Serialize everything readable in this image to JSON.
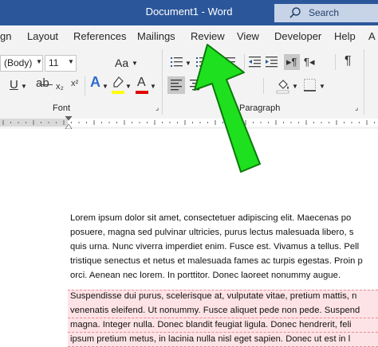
{
  "title_bar": {
    "title": "Document1  -  Word",
    "search_label": "Search",
    "colors": {
      "bar": "#2b579a",
      "search_bg": "#c7d3e6"
    }
  },
  "tabs": [
    "gn",
    "Layout",
    "References",
    "Mailings",
    "Review",
    "View",
    "Developer",
    "Help",
    "A"
  ],
  "ribbon": {
    "font_name": "(Body)",
    "font_size": "11",
    "grow_shrink": "Aa",
    "font_group_label": "Font",
    "paragraph_group_label": "Paragraph",
    "font_color_letter": "A",
    "highlight_color": "#ffff00",
    "font_color": "#e00000",
    "pilcrow": "¶"
  },
  "document": {
    "paragraph1": [
      "Lorem ipsum dolor sit amet, consectetuer adipiscing elit. Maecenas po",
      "posuere, magna sed pulvinar ultricies, purus lectus malesuada libero, s",
      "quis urna. Nunc viverra imperdiet enim. Fusce est. Vivamus a tellus. Pell",
      "tristique senectus et netus et malesuada fames ac turpis egestas. Proin p",
      "orci. Aenean nec lorem. In porttitor. Donec laoreet nonummy augue."
    ],
    "paragraph2": [
      "Suspendisse dui purus, scelerisque at, vulputate vitae, pretium mattis, n",
      "venenatis eleifend. Ut nonummy. Fusce aliquet pede non pede. Suspend",
      "magna. Integer nulla. Donec blandit feugiat ligula. Donec hendrerit, feli",
      "ipsum pretium metus, in lacinia nulla nisl eget sapien. Donec ut est in l"
    ],
    "highlight_color": "#fde3e6"
  },
  "annotation": {
    "arrow_color": "#1ee01e",
    "target": "Review"
  }
}
